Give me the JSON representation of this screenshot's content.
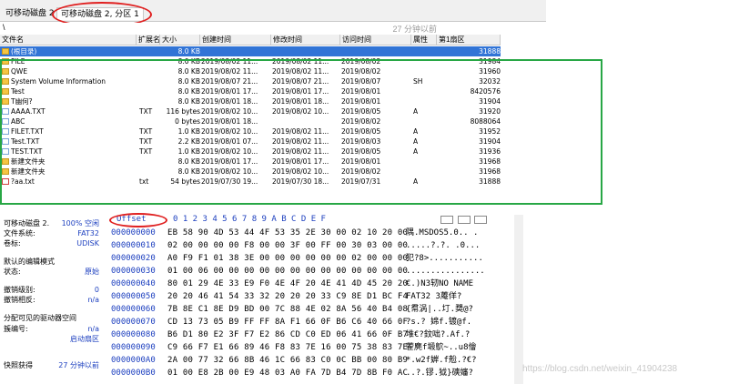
{
  "tabs": [
    {
      "label": "可移动磁盘 2"
    },
    {
      "label": "可移动磁盘 2, 分区 1"
    }
  ],
  "path": "\\",
  "status_right": "27 分钟以前",
  "columns": [
    "文件名",
    "扩展名",
    "大小",
    "创建时间",
    "修改时间",
    "访问时间",
    "属性",
    "第1扇区"
  ],
  "rows": [
    {
      "name": "(根目录)",
      "ext": "",
      "size": "8.0 KB",
      "created": "",
      "modified": "",
      "accessed": "",
      "attr": "",
      "sector": "31888",
      "icon": "folder"
    },
    {
      "name": "FILE",
      "ext": "",
      "size": "8.0 KB",
      "created": "2019/08/02  11...",
      "modified": "2019/08/02  11...",
      "accessed": "2019/08/02",
      "attr": "",
      "sector": "31984",
      "icon": "folder"
    },
    {
      "name": "QWE",
      "ext": "",
      "size": "8.0 KB",
      "created": "2019/08/02  11...",
      "modified": "2019/08/02  11...",
      "accessed": "2019/08/02",
      "attr": "",
      "sector": "31960",
      "icon": "folder"
    },
    {
      "name": "System Volume Information",
      "ext": "",
      "size": "8.0 KB",
      "created": "2019/08/07  21...",
      "modified": "2019/08/07  21...",
      "accessed": "2019/08/07",
      "attr": "SH",
      "sector": "32032",
      "icon": "folder"
    },
    {
      "name": "Test",
      "ext": "",
      "size": "8.0 KB",
      "created": "2019/08/01  17...",
      "modified": "2019/08/01  17...",
      "accessed": "2019/08/01",
      "attr": "",
      "sector": "8420576",
      "icon": "folder"
    },
    {
      "name": "T幽何?",
      "ext": "",
      "size": "8.0 KB",
      "created": "2019/08/01  18...",
      "modified": "2019/08/01  18...",
      "accessed": "2019/08/01",
      "attr": "",
      "sector": "31904",
      "icon": "folder"
    },
    {
      "name": "AAAA.TXT",
      "ext": "TXT",
      "size": "116 bytes",
      "created": "2019/08/02  10...",
      "modified": "2019/08/02  10...",
      "accessed": "2019/08/05",
      "attr": "A",
      "sector": "31920",
      "icon": "file"
    },
    {
      "name": "ABC",
      "ext": "",
      "size": "0 bytes",
      "created": "2019/08/01  18...",
      "modified": "",
      "accessed": "2019/08/02",
      "attr": "",
      "sector": "8088064",
      "icon": "file"
    },
    {
      "name": "FILET.TXT",
      "ext": "TXT",
      "size": "1.0 KB",
      "created": "2019/08/02  10...",
      "modified": "2019/08/02  11...",
      "accessed": "2019/08/05",
      "attr": "A",
      "sector": "31952",
      "icon": "file"
    },
    {
      "name": "Test.TXT",
      "ext": "TXT",
      "size": "2.2 KB",
      "created": "2019/08/01  07...",
      "modified": "2019/08/02  11...",
      "accessed": "2019/08/03",
      "attr": "A",
      "sector": "31904",
      "icon": "file"
    },
    {
      "name": "TEST.TXT",
      "ext": "TXT",
      "size": "1.0 KB",
      "created": "2019/08/02  10...",
      "modified": "2019/08/02  11...",
      "accessed": "2019/08/05",
      "attr": "A",
      "sector": "31936",
      "icon": "file"
    },
    {
      "name": "新建文件夹",
      "ext": "",
      "size": "8.0 KB",
      "created": "2019/08/01  17...",
      "modified": "2019/08/01  17...",
      "accessed": "2019/08/01",
      "attr": "",
      "sector": "31968",
      "icon": "folder"
    },
    {
      "name": "新建文件夹",
      "ext": "",
      "size": "8.0 KB",
      "created": "2019/08/02  10...",
      "modified": "2019/08/02  10...",
      "accessed": "2019/08/02",
      "attr": "",
      "sector": "31968",
      "icon": "folder"
    },
    {
      "name": "?aa.txt",
      "ext": "txt",
      "size": "54 bytes",
      "created": "2019/07/30  19...",
      "modified": "2019/07/30  18...",
      "accessed": "2019/07/31",
      "attr": "A",
      "sector": "31888",
      "icon": "del"
    }
  ],
  "left_panel": {
    "title_key": "可移动磁盘 2.",
    "title_val": "100% 空闲",
    "items": [
      {
        "k": "文件系统:",
        "v": "FAT32"
      },
      {
        "k": "卷标:",
        "v": "UDISK"
      },
      {
        "k": "默认的编辑模式",
        "v": ""
      },
      {
        "k": "状态:",
        "v": "原始"
      },
      {
        "k": "撤销级别:",
        "v": "0"
      },
      {
        "k": "撤销相反:",
        "v": "n/a"
      },
      {
        "k": "分配可见的驱动器空间",
        "v": ""
      },
      {
        "k": "簇编号:",
        "v": "n/a"
      },
      {
        "k": "",
        "v": "启动扇区"
      },
      {
        "k": "快照获得",
        "v": "27 分钟以前"
      }
    ]
  },
  "hex": {
    "header_offset": "Offset",
    "header_cols": "0  1  2  3  4  5  6  7   8  9  A  B  C  D  E  F",
    "lines": [
      {
        "off": "000000000",
        "bytes": "EB 58 90 4D 53 44 4F 53  35 2E 30 00 02 10 20 00",
        "ascii": "隅.MSDOS5.0.. ."
      },
      {
        "off": "000000010",
        "bytes": "02 00 00 00 00 F8 00 00  3F 00 FF 00 30 03 00 00",
        "ascii": ".....?.?.  .0..."
      },
      {
        "off": "000000020",
        "bytes": "A0 F9 F1 01 38 3E 00 00  00 00 00 00 02 00 00 00",
        "ascii": "犯?8>..........."
      },
      {
        "off": "000000030",
        "bytes": "01 00 06 00 00 00 00 00  00 00 00 00 00 00 00 00",
        "ascii": "................"
      },
      {
        "off": "000000040",
        "bytes": "80 01 29 4E 33 E9 F0 4E  4F 20 4E 41 4D 45 20 20",
        "ascii": "€.)N3轫NO NAME  "
      },
      {
        "off": "000000050",
        "bytes": "20 20 46 41 54 33 32 20  20 20 33 C9 8E D1 BC F4",
        "ascii": "  FAT32   3蓭佯?"
      },
      {
        "off": "000000060",
        "bytes": "7B 8E C1 8E D9 BD 00 7C  88 4E 02 8A 56 40 B4 08",
        "ascii": "{帬涡|..圢.奦@?"
      },
      {
        "off": "000000070",
        "bytes": "CD 13 73 05 B9 FF FF 8A  F1 66 0F B6 C6 40 66 0F",
        "ascii": "?s.? 婂f.镀@f."
      },
      {
        "off": "000000080",
        "bytes": "B6 D1 80 E2 3F F7 E2 86  CD C0 ED 06 41 66 0F B7",
        "ascii": "堆€?鈫咄?.Af.?"
      },
      {
        "off": "000000090",
        "bytes": "C9 66 F7 E1 66 89 46 F8  83 7E 16 00 75 38 83 7E",
        "ascii": "蒮麂f塅鴥~..u8儈"
      },
      {
        "off": "0000000A0",
        "bytes": "2A 00 77 32 66 8B 46 1C  66 83 C0 0C BB 00 80 B9",
        "ascii": "*.w2f婩.f兝.?€?"
      },
      {
        "off": "0000000B0",
        "bytes": "01 00 E8 2B 00 E9 48 03  A0 FA 7D B4 7D 8B F0 AC",
        "ascii": "..?.镠.狘}磢嬸?"
      }
    ]
  },
  "watermark": "https://blog.csdn.net/weixin_41904238"
}
